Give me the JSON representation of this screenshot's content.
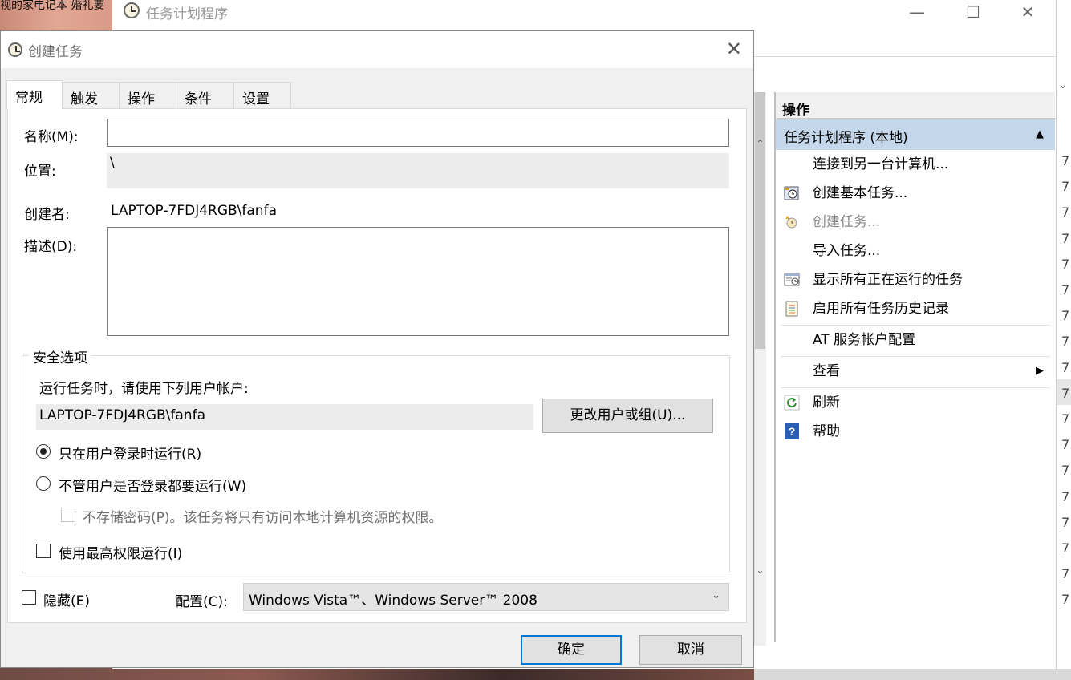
{
  "background": {
    "corner_text": "视的家电记本  婚礼要"
  },
  "main_window": {
    "title": "任务计划程序",
    "minimize": "—",
    "maximize": "☐",
    "close": "✕",
    "actions": {
      "header": "操作",
      "group_title": "任务计划程序 (本地)",
      "items": [
        {
          "label": "连接到另一台计算机...",
          "icon": "none",
          "disabled": false
        },
        {
          "label": "创建基本任务...",
          "icon": "wizard-task-icon",
          "disabled": false
        },
        {
          "label": "创建任务...",
          "icon": "create-task-icon",
          "disabled": true
        },
        {
          "label": "导入任务...",
          "icon": "none",
          "disabled": false
        },
        {
          "label": "显示所有正在运行的任务",
          "icon": "running-tasks-icon",
          "disabled": false
        },
        {
          "label": "启用所有任务历史记录",
          "icon": "history-icon",
          "disabled": false
        },
        {
          "label": "AT 服务帐户配置",
          "icon": "none",
          "disabled": false
        },
        {
          "label": "查看",
          "icon": "none",
          "disabled": false,
          "submenu": true
        },
        {
          "label": "刷新",
          "icon": "refresh-icon",
          "disabled": false
        },
        {
          "label": "帮助",
          "icon": "help-icon",
          "disabled": false
        }
      ]
    },
    "right_column_digits": [
      "7",
      "7",
      "7",
      "7",
      "7",
      "7",
      "7",
      "7",
      "7",
      "7",
      "7",
      "7",
      "7",
      "7",
      "7",
      "7",
      "7",
      "7"
    ]
  },
  "dialog": {
    "title": "创建任务",
    "close": "✕",
    "tabs": [
      "常规",
      "触发器",
      "操作",
      "条件",
      "设置"
    ],
    "active_tab": "常规",
    "name_label": "名称(M):",
    "name_value": "",
    "location_label": "位置:",
    "location_value": "\\",
    "author_label": "创建者:",
    "author_value": "LAPTOP-7FDJ4RGB\\fanfa",
    "description_label": "描述(D):",
    "description_value": "",
    "security": {
      "title": "安全选项",
      "run_as_prompt": "运行任务时，请使用下列用户帐户:",
      "user_account": "LAPTOP-7FDJ4RGB\\fanfa",
      "change_user_button": "更改用户或组(U)...",
      "radio_logged_on": "只在用户登录时运行(R)",
      "radio_logged_on_selected": true,
      "radio_whether_logged": "不管用户是否登录都要运行(W)",
      "no_store_password": "不存储密码(P)。该任务将只有访问本地计算机资源的权限。",
      "highest_privileges": "使用最高权限运行(I)"
    },
    "hidden_label": "隐藏(E)",
    "config_label": "配置(C):",
    "config_value": "Windows Vista™、Windows Server™ 2008",
    "ok_button": "确定",
    "cancel_button": "取消"
  }
}
